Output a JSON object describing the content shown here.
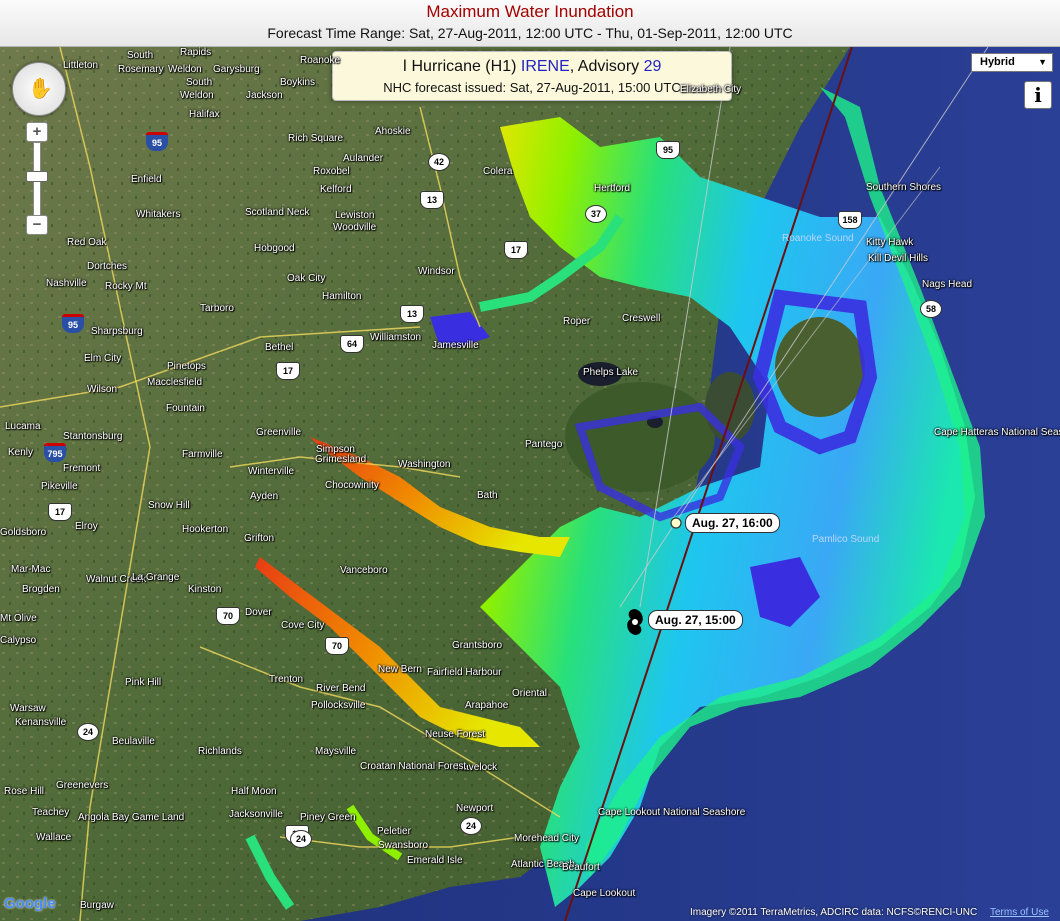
{
  "header": {
    "title": "Maximum Water Inundation",
    "time_range": "Forecast Time Range:  Sat, 27-Aug-2011, 12:00 UTC  -  Thu, 01-Sep-2011, 12:00 UTC"
  },
  "storm": {
    "prefix": "Hurricane (H1)",
    "name": "IRENE",
    "advisory_label": ", Advisory",
    "advisory_number": "29",
    "issued": "NHC forecast issued: Sat, 27-Aug-2011, 15:00 UTC",
    "icon": "hurricane-symbol-icon"
  },
  "controls": {
    "map_type": "Hybrid",
    "info_label": "i",
    "zoom_in": "+",
    "zoom_out": "−"
  },
  "track": {
    "positions": [
      {
        "label": "Aug. 27, 16:00"
      },
      {
        "label": "Aug. 27, 15:00"
      }
    ]
  },
  "footer": {
    "logo": "Google",
    "attribution": "Imagery ©2011 TerraMetrics, ADCIRC data: NCFS©RENCI-UNC",
    "terms": "Terms of Use"
  },
  "places": [
    "South",
    "Rapids",
    "Littleton",
    "Rosemary",
    "Weldon",
    "Garysburg",
    "Roanoke",
    "South",
    "Boykins",
    "Weldon",
    "Halifax",
    "Jackson",
    "Rich Square",
    "Ahoskie",
    "Aulander",
    "Enfield",
    "Roxobel",
    "Kelford",
    "Colera",
    "Hertford",
    "Elizabeth City",
    "Scotland Neck",
    "Lewiston",
    "Woodville",
    "Whitakers",
    "Hobgood",
    "Red Oak",
    "Dortches",
    "Nashville",
    "Rocky Mt",
    "Oak City",
    "Hamilton",
    "Windsor",
    "Tarboro",
    "Williamston",
    "Jamesville",
    "Roper",
    "Creswell",
    "Bethel",
    "Sharpsburg",
    "Elm City",
    "Pinetops",
    "Macclesfield",
    "Wilson",
    "Fountain",
    "Phelps Lake",
    "Greenville",
    "Simpson",
    "Grimesland",
    "Chocowinity",
    "Washington",
    "Pantego",
    "Stantonsburg",
    "Farmville",
    "Winterville",
    "Ayden",
    "Lucama",
    "Kenly",
    "Fremont",
    "Pikeville",
    "Snow Hill",
    "Hookerton",
    "Bath",
    "Goldsboro",
    "Elroy",
    "Grifton",
    "Vanceboro",
    "Mar-Mac",
    "Walnut Creek",
    "La Grange",
    "Kinston",
    "Brogden",
    "Dover",
    "Cove City",
    "Grantsboro",
    "Mt Olive",
    "Calypso",
    "New Bern",
    "Fairfield Harbour",
    "Trenton",
    "River Bend",
    "Pollocksville",
    "Oriental",
    "Arapahoe",
    "Pink Hill",
    "Warsaw",
    "Kenansville",
    "Beulaville",
    "Richlands",
    "Maysville",
    "Neuse Forest",
    "Havelock",
    "Croatan National Forest",
    "Half Moon",
    "Rose Hill",
    "Greenevers",
    "Teachey",
    "Angola Bay Game Land",
    "Jacksonville",
    "Piney Green",
    "Newport",
    "Morehead City",
    "Swansboro",
    "Peletier",
    "Emerald Isle",
    "Atlantic Beach",
    "Cape Lookout",
    "Beaufort",
    "Wallace",
    "Burgaw",
    "Kitty Hawk",
    "Kill Devil Hills",
    "Nags Head",
    "Southern Shores",
    "Cape Hatteras National Seashore",
    "Cape Lookout National Seashore",
    "Pamlico Sound",
    "Roanoke Sound"
  ],
  "shields": {
    "us": [
      "95",
      "17",
      "17",
      "17",
      "13",
      "13",
      "64",
      "70",
      "70",
      "17",
      "158"
    ],
    "nc": [
      "42",
      "37",
      "24",
      "24",
      "58",
      "24"
    ],
    "interstate": [
      "95",
      "95",
      "795"
    ]
  }
}
